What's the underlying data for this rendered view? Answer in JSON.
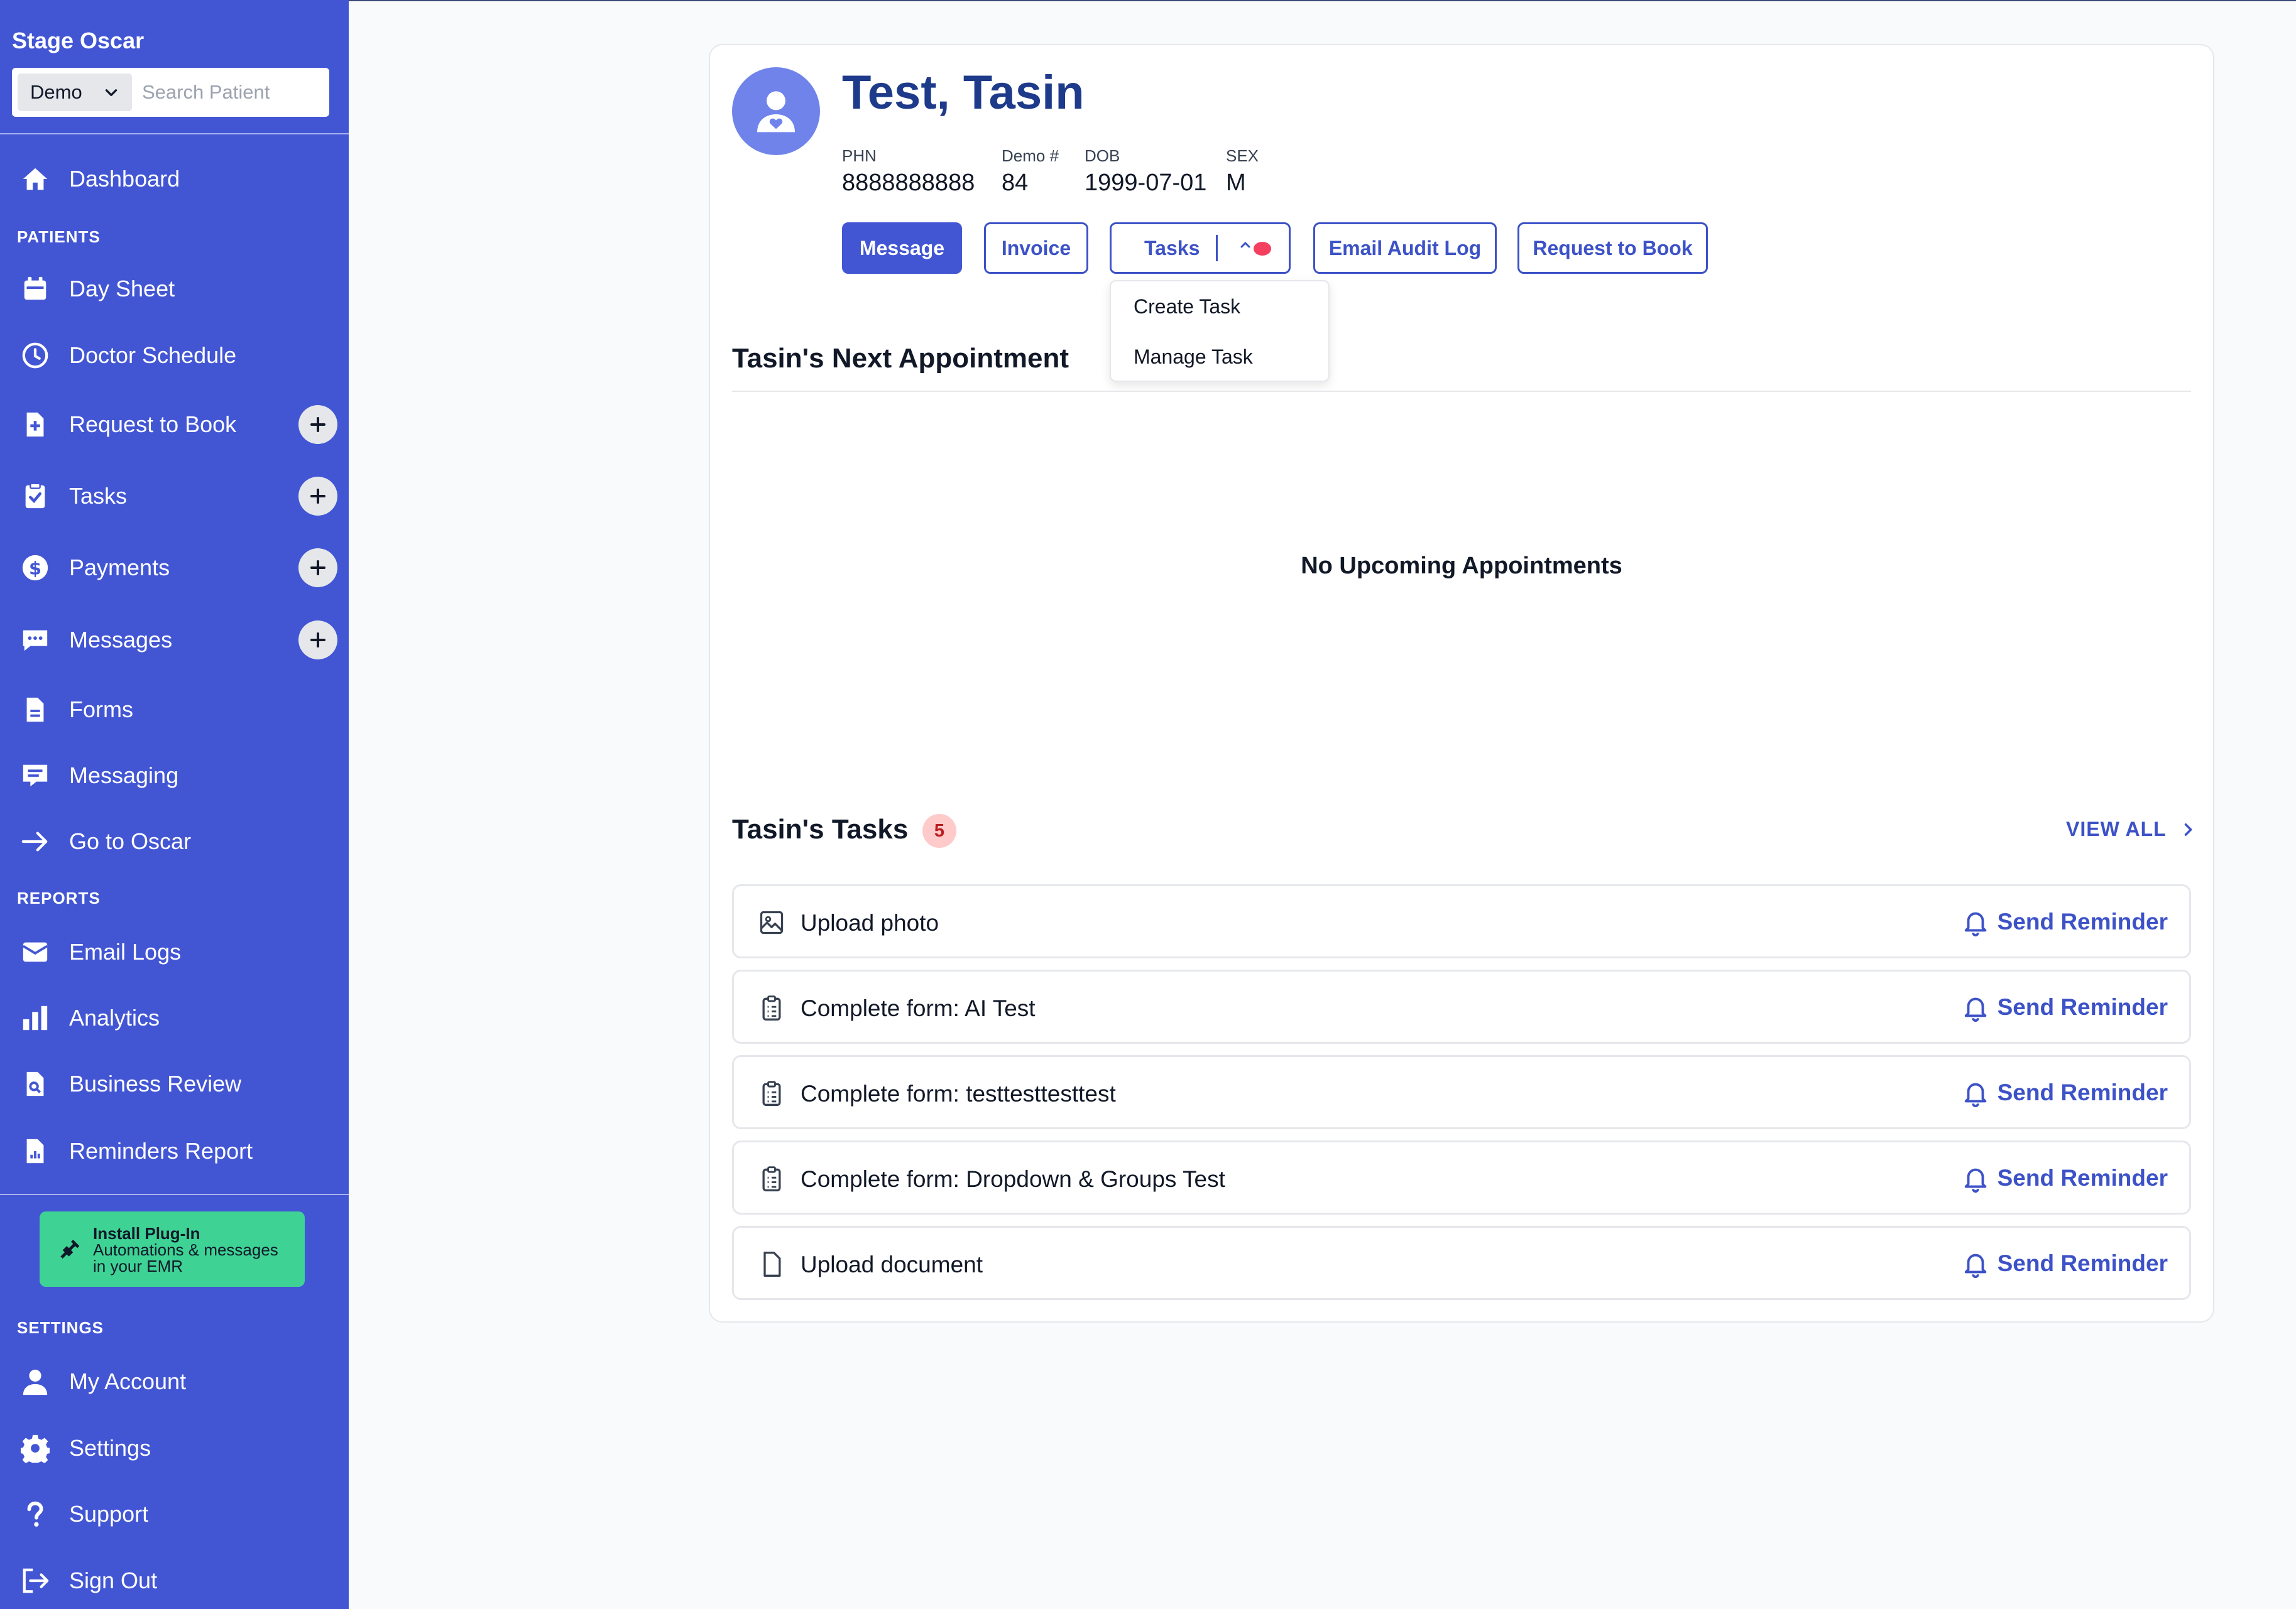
{
  "sidebar": {
    "brand": "Stage Oscar",
    "demo_select": "Demo",
    "search_placeholder": "Search Patient",
    "dashboard": "Dashboard",
    "patients_section": "PATIENTS",
    "day_sheet": "Day Sheet",
    "doctor_schedule": "Doctor Schedule",
    "request_to_book": "Request to Book",
    "tasks": "Tasks",
    "payments": "Payments",
    "messages": "Messages",
    "forms": "Forms",
    "messaging": "Messaging",
    "go_to_oscar": "Go to Oscar",
    "reports_section": "REPORTS",
    "email_logs": "Email Logs",
    "analytics": "Analytics",
    "business_review": "Business Review",
    "reminders_report": "Reminders Report",
    "plugin_title": "Install Plug-In",
    "plugin_sub": "Automations & messages in your EMR",
    "settings_section": "SETTINGS",
    "my_account": "My Account",
    "settings": "Settings",
    "support": "Support",
    "sign_out": "Sign Out"
  },
  "patient": {
    "name": "Test, Tasin",
    "phn_label": "PHN",
    "phn": "8888888888",
    "demo_label": "Demo #",
    "demo": "84",
    "dob_label": "DOB",
    "dob": "1999-07-01",
    "sex_label": "SEX",
    "sex": "M"
  },
  "actions": {
    "message": "Message",
    "invoice": "Invoice",
    "tasks": "Tasks",
    "email_audit_log": "Email Audit Log",
    "request_to_book": "Request to Book"
  },
  "tasks_menu": {
    "create": "Create Task",
    "manage": "Manage Task"
  },
  "appointment": {
    "title": "Tasin's Next Appointment",
    "empty": "No Upcoming Appointments"
  },
  "task_list": {
    "title": "Tasin's Tasks",
    "count": "5",
    "view_all": "VIEW ALL",
    "reminder_label": "Send Reminder",
    "items": [
      {
        "label": "Upload photo",
        "icon": "image-icon"
      },
      {
        "label": "Complete form: AI Test",
        "icon": "clipboard-icon"
      },
      {
        "label": "Complete form: testtesttesttest",
        "icon": "clipboard-icon"
      },
      {
        "label": "Complete form: Dropdown & Groups Test",
        "icon": "clipboard-icon"
      },
      {
        "label": "Upload document",
        "icon": "document-icon"
      }
    ]
  },
  "colors": {
    "sidebar": "#4256d4",
    "accent": "#3d52c7",
    "plugin": "#3ed394",
    "badge_bg": "#fecaca",
    "notify_dot": "#f43f5e"
  }
}
